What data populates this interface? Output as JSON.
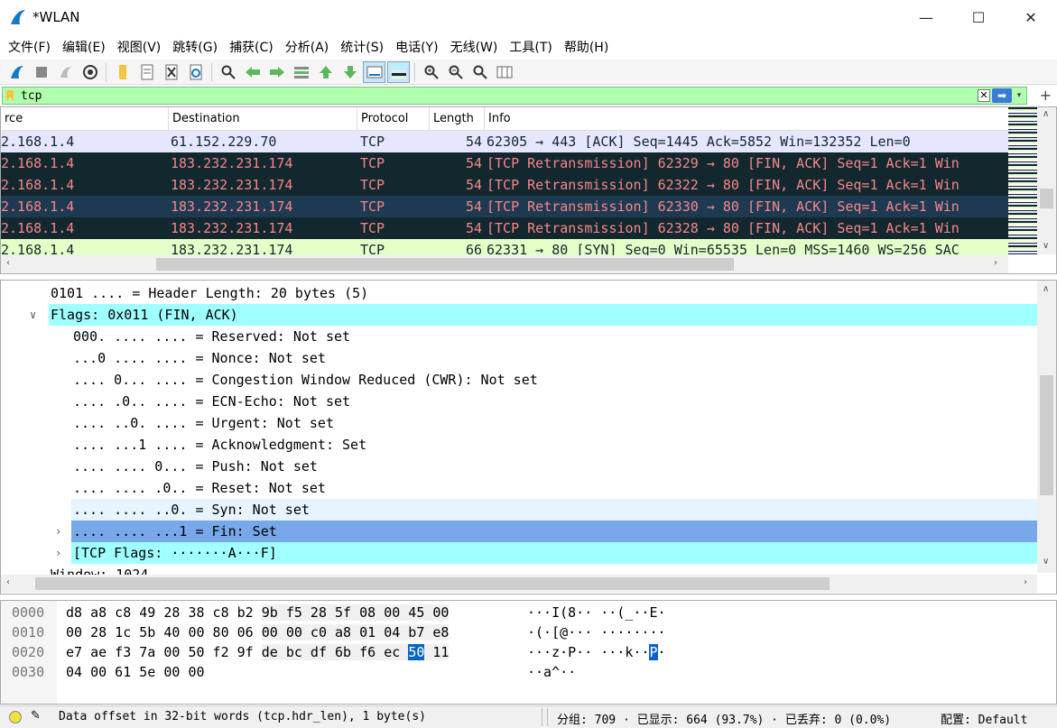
{
  "window": {
    "title": "*WLAN",
    "minimize": "—",
    "maximize": "☐",
    "close": "✕"
  },
  "menu": [
    "文件(F)",
    "编辑(E)",
    "视图(V)",
    "跳转(G)",
    "捕获(C)",
    "分析(A)",
    "统计(S)",
    "电话(Y)",
    "无线(W)",
    "工具(T)",
    "帮助(H)"
  ],
  "filter": {
    "value": "tcp",
    "clear": "✕",
    "apply": "➡",
    "dropdown": "▾",
    "add": "+"
  },
  "packet_list": {
    "columns": [
      "rce",
      "Destination",
      "Protocol",
      "Length",
      "Info"
    ],
    "rows": [
      {
        "src": "2.168.1.4",
        "dst": "61.152.229.70",
        "proto": "TCP",
        "len": "54",
        "info": "62305 → 443 [ACK] Seq=1445 Ack=5852 Win=132352 Len=0",
        "style": "ack"
      },
      {
        "src": "2.168.1.4",
        "dst": "183.232.231.174",
        "proto": "TCP",
        "len": "54",
        "info": "[TCP Retransmission] 62329 → 80 [FIN, ACK] Seq=1 Ack=1 Win",
        "style": "bad"
      },
      {
        "src": "2.168.1.4",
        "dst": "183.232.231.174",
        "proto": "TCP",
        "len": "54",
        "info": "[TCP Retransmission] 62322 → 80 [FIN, ACK] Seq=1 Ack=1 Win",
        "style": "bad"
      },
      {
        "src": "2.168.1.4",
        "dst": "183.232.231.174",
        "proto": "TCP",
        "len": "54",
        "info": "[TCP Retransmission] 62330 → 80 [FIN, ACK] Seq=1 Ack=1 Win",
        "style": "bad-sel"
      },
      {
        "src": "2.168.1.4",
        "dst": "183.232.231.174",
        "proto": "TCP",
        "len": "54",
        "info": "[TCP Retransmission] 62328 → 80 [FIN, ACK] Seq=1 Ack=1 Win",
        "style": "bad"
      },
      {
        "src": "2.168.1.4",
        "dst": "183.232.231.174",
        "proto": "TCP",
        "len": "66",
        "info": "62331 → 80 [SYN] Seq=0 Win=65535 Len=0 MSS=1460 WS=256 SAC",
        "style": "syn"
      }
    ]
  },
  "details": [
    {
      "text": "0101 .... = Header Length: 20 bytes (5)",
      "indent": 1,
      "hl": "none",
      "toggle": ""
    },
    {
      "text": "Flags: 0x011 (FIN, ACK)",
      "indent": 1,
      "hl": "cyan",
      "toggle": "∨"
    },
    {
      "text": "000. .... .... = Reserved: Not set",
      "indent": 2,
      "hl": "none",
      "toggle": ""
    },
    {
      "text": "...0 .... .... = Nonce: Not set",
      "indent": 2,
      "hl": "none",
      "toggle": ""
    },
    {
      "text": ".... 0... .... = Congestion Window Reduced (CWR): Not set",
      "indent": 2,
      "hl": "none",
      "toggle": ""
    },
    {
      "text": ".... .0.. .... = ECN-Echo: Not set",
      "indent": 2,
      "hl": "none",
      "toggle": ""
    },
    {
      "text": ".... ..0. .... = Urgent: Not set",
      "indent": 2,
      "hl": "none",
      "toggle": ""
    },
    {
      "text": ".... ...1 .... = Acknowledgment: Set",
      "indent": 2,
      "hl": "none",
      "toggle": ""
    },
    {
      "text": ".... .... 0... = Push: Not set",
      "indent": 2,
      "hl": "none",
      "toggle": ""
    },
    {
      "text": ".... .... .0.. = Reset: Not set",
      "indent": 2,
      "hl": "none",
      "toggle": ""
    },
    {
      "text": ".... .... ..0. = Syn: Not set",
      "indent": 2,
      "hl": "light",
      "toggle": ""
    },
    {
      "text": ".... .... ...1 = Fin: Set",
      "indent": 2,
      "hl": "blue",
      "toggle": "›"
    },
    {
      "text": "[TCP Flags: ·······A···F]",
      "indent": 2,
      "hl": "cyan",
      "toggle": "›"
    },
    {
      "text": "Window: 1024",
      "indent": 1,
      "hl": "none",
      "toggle": ""
    }
  ],
  "bytes": [
    {
      "offset": "0000",
      "hex1": "d8 a8 c8 49 28 38 c8 b2",
      "hex2": "9b f5 28 5f 08 00 45 00",
      "hex2_sel": "",
      "hex2_tail": "",
      "ascii": "···I(8··  ··(_··E·",
      "ascii_sel": "",
      "ascii_tail": ""
    },
    {
      "offset": "0010",
      "hex1": "00 28 1c 5b 40 00 80 06",
      "hex2": "00 00 c0 a8 01 04 b7 e8",
      "hex2_sel": "",
      "hex2_tail": "",
      "ascii": "·(·[@···  ········",
      "ascii_sel": "",
      "ascii_tail": ""
    },
    {
      "offset": "0020",
      "hex1": "e7 ae f3 7a 00 50 f2 9f",
      "hex2": "de bc df 6b f6 ec ",
      "hex2_sel": "50",
      "hex2_tail": " 11",
      "ascii": "···z·P··  ···k··",
      "ascii_sel": "P",
      "ascii_tail": "·"
    },
    {
      "offset": "0030",
      "hex1": "04 00 61 5e 00 00",
      "hex2": "",
      "hex2_sel": "",
      "hex2_tail": "",
      "ascii": "··a^··",
      "ascii_sel": "",
      "ascii_tail": ""
    }
  ],
  "status": {
    "field": "Data offset in 32-bit words (tcp.hdr_len), 1 byte(s)",
    "stats": "分组: 709 · 已显示: 664 (93.7%) · 已丢弃: 0 (0.0%)",
    "profile": "配置: Default"
  },
  "colors": {
    "filter_bg": "#afffaf",
    "ack_row": "#e7e6ff",
    "bad_row": "#12272e",
    "bad_text": "#f78787",
    "syn_row": "#e4ffc7",
    "cyan": "#a0ffff",
    "selected": "#78a8ea"
  }
}
